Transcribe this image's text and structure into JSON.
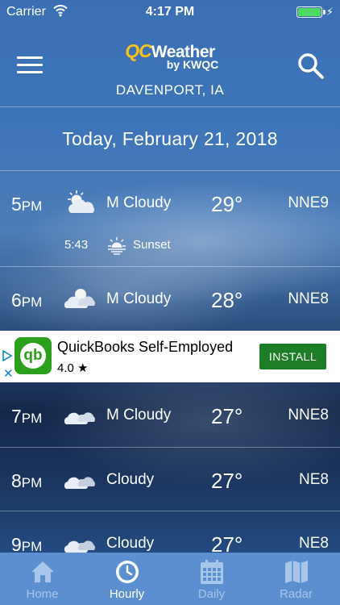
{
  "status_bar": {
    "carrier": "Carrier",
    "time": "4:17 PM"
  },
  "header": {
    "logo_qc": "QC",
    "logo_weather": "Weather",
    "logo_by": "by KWQC",
    "location": "DAVENPORT, IA"
  },
  "date": "Today, February 21, 2018",
  "hours": [
    {
      "hour": "5",
      "ampm": "PM",
      "icon": "sun-cloud-icon",
      "condition": "M Cloudy",
      "temp": "29°",
      "wind": "NNE9"
    },
    {
      "hour": "6",
      "ampm": "PM",
      "icon": "sun-cloud-icon",
      "condition": "M Cloudy",
      "temp": "28°",
      "wind": "NNE8"
    },
    {
      "hour": "7",
      "ampm": "PM",
      "icon": "cloud-icon",
      "condition": "M Cloudy",
      "temp": "27°",
      "wind": "NNE8"
    },
    {
      "hour": "8",
      "ampm": "PM",
      "icon": "cloud-icon",
      "condition": "Cloudy",
      "temp": "27°",
      "wind": "NE8"
    },
    {
      "hour": "9",
      "ampm": "PM",
      "icon": "cloud-icon",
      "condition": "Cloudy",
      "temp": "27°",
      "wind": "NE8"
    }
  ],
  "sunset": {
    "time": "5:43",
    "label": "Sunset"
  },
  "ad": {
    "title": "QuickBooks Self-Employed",
    "rating": "4.0",
    "install_label": "INSTALL",
    "logo_text": "qb"
  },
  "tabs": [
    {
      "label": "Home",
      "active": false
    },
    {
      "label": "Hourly",
      "active": true
    },
    {
      "label": "Daily",
      "active": false
    },
    {
      "label": "Radar",
      "active": false
    }
  ],
  "colors": {
    "accent": "#f6c21c",
    "tabbar": "#5b8fd0",
    "install": "#1e7e28",
    "battery": "#4cd964"
  }
}
